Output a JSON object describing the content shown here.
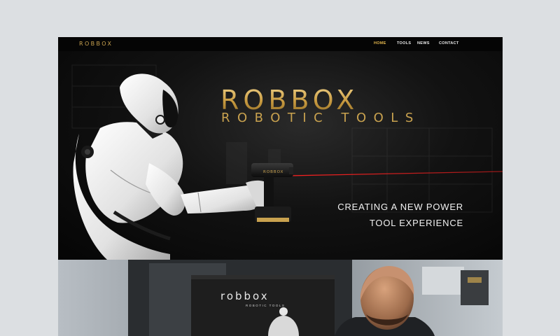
{
  "site": {
    "brand": "ROBBOX"
  },
  "nav": {
    "items": [
      {
        "label": "HOME",
        "active": true
      },
      {
        "label": "TOOLS",
        "active": false
      },
      {
        "label": "NEWS",
        "active": false
      },
      {
        "label": "CONTACT",
        "active": false
      }
    ]
  },
  "hero": {
    "logo": "ROBBOX",
    "subtitle": "ROBOTIC TOOLS",
    "tagline_line1": "CREATING A NEW POWER",
    "tagline_line2": "TOOL EXPERIENCE",
    "tool_label": "ROBBOX"
  },
  "photo_section": {
    "banner_logo": "robbox",
    "banner_sub": "ROBOTIC TOOLS"
  },
  "colors": {
    "accent_gold": "#c9a24f",
    "nav_active": "#e3b64d",
    "laser": "#ff2020",
    "page_bg": "#dcdfe2"
  }
}
